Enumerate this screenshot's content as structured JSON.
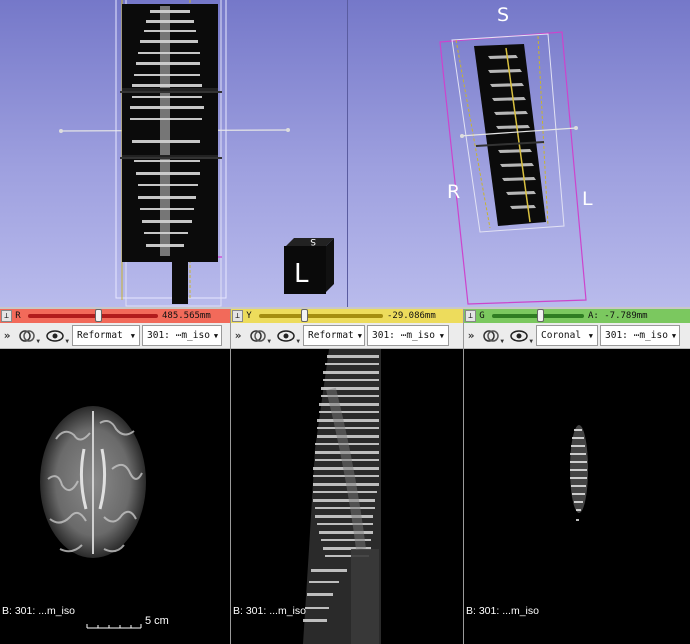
{
  "view3d_left": {
    "orientation_cube_letter": "L",
    "orientation_cube_top_letter": "S"
  },
  "view3d_right": {
    "label_superior": "S",
    "label_right": "R",
    "label_left": "L"
  },
  "slice_views": {
    "red": {
      "axis_letter": "R",
      "color": "#f26a5a",
      "slider_fraction": 0.53,
      "position": "485.565mm",
      "orientation": "Reformat",
      "volume": "301: ⋯m_iso",
      "background_label": "B: 301: ...m_iso",
      "scale_label": "5 cm"
    },
    "yellow": {
      "axis_letter": "Y",
      "color": "#eddc5c",
      "slider_fraction": 0.36,
      "position": "-29.086mm",
      "orientation": "Reformat",
      "volume": "301: ⋯m_iso",
      "background_label": "B: 301: ...m_iso"
    },
    "green": {
      "axis_letter": "G",
      "color": "#7bc85f",
      "slider_fraction": 0.52,
      "position": "A: -7.789mm",
      "orientation": "Coronal",
      "volume": "301: ⋯m_iso",
      "background_label": "B: 301: ...m_iso"
    }
  },
  "colors": {
    "bg_top": "#7578c9",
    "bg_bottom": "#b9bbec",
    "bounding_box": "#cc44cc"
  },
  "icons": {
    "pin": "pin-icon",
    "expand": "chevron-double-right-icon",
    "link": "link-rings-icon",
    "visibility": "eye-icon"
  }
}
